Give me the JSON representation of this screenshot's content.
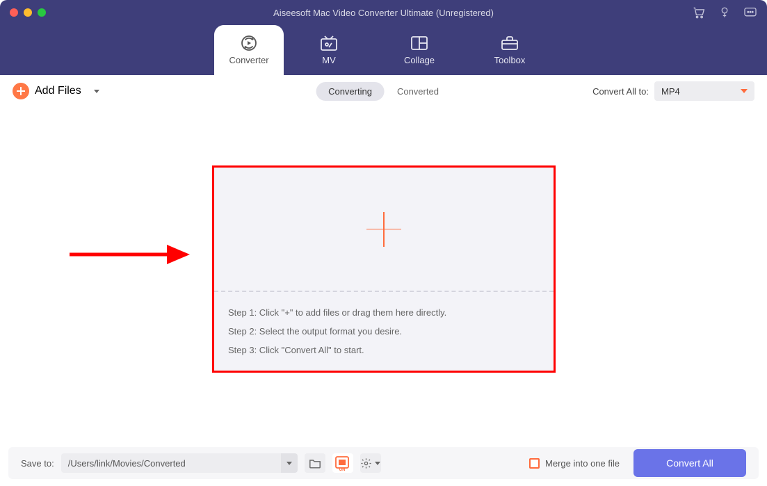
{
  "window": {
    "title": "Aiseesoft Mac Video Converter Ultimate (Unregistered)"
  },
  "nav": {
    "tabs": [
      {
        "label": "Converter",
        "icon": "convert-icon",
        "active": true
      },
      {
        "label": "MV",
        "icon": "mv-icon",
        "active": false
      },
      {
        "label": "Collage",
        "icon": "collage-icon",
        "active": false
      },
      {
        "label": "Toolbox",
        "icon": "toolbox-icon",
        "active": false
      }
    ]
  },
  "toolbar": {
    "add_files_label": "Add Files",
    "segments": {
      "converting": "Converting",
      "converted": "Converted"
    },
    "convert_all_to_label": "Convert All to:",
    "selected_format": "MP4"
  },
  "dropzone": {
    "steps": [
      "Step 1: Click \"+\" to add files or drag them here directly.",
      "Step 2: Select the output format you desire.",
      "Step 3: Click \"Convert All\" to start."
    ]
  },
  "footer": {
    "save_to_label": "Save to:",
    "save_path": "/Users/link/Movies/Converted",
    "merge_label": "Merge into one file",
    "convert_all_button": "Convert All"
  },
  "colors": {
    "header_bg": "#3e3e7a",
    "accent_orange": "#ff6b3d",
    "primary_blue": "#6a73e8",
    "annotation_red": "#ff0000"
  }
}
